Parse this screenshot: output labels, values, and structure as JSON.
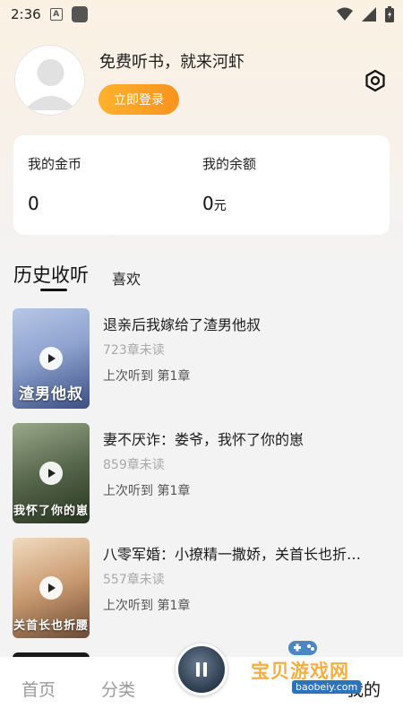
{
  "status_bar": {
    "time": "2:36",
    "a_label": "A"
  },
  "profile": {
    "slogan": "免费听书，就来河虾",
    "login_label": "立即登录"
  },
  "wallet": {
    "coins_label": "我的金币",
    "coins_value": "0",
    "balance_label": "我的余额",
    "balance_value": "0",
    "balance_unit": "元"
  },
  "tabs": {
    "history": "历史收听",
    "like": "喜欢"
  },
  "books": [
    {
      "title": "退亲后我嫁给了渣男他叔",
      "unread": "723章未读",
      "last": "上次听到 第1章",
      "cover_text": "渣男他叔",
      "cover_colors": [
        "#9fb2d6",
        "#3b4f84"
      ]
    },
    {
      "title": "妻不厌诈：娄爷，我怀了你的崽",
      "unread": "859章未读",
      "last": "上次听到 第1章",
      "cover_text": "我怀了你的崽",
      "cover_colors": [
        "#7b8a6f",
        "#26341f"
      ]
    },
    {
      "title": "八零军婚：小撩精一撒娇，关首长也折…",
      "unread": "557章未读",
      "last": "上次听到 第1章",
      "cover_text": "关首长也折腰",
      "cover_colors": [
        "#e8c8a4",
        "#6b4a34"
      ]
    }
  ],
  "nav": {
    "home": "首页",
    "category": "分类",
    "mine": "我的"
  },
  "watermark": {
    "text": "宝贝游戏网",
    "url": "baobeiy.com"
  },
  "colors": {
    "accent": "#f7931e",
    "background": "#f3f3f3"
  }
}
